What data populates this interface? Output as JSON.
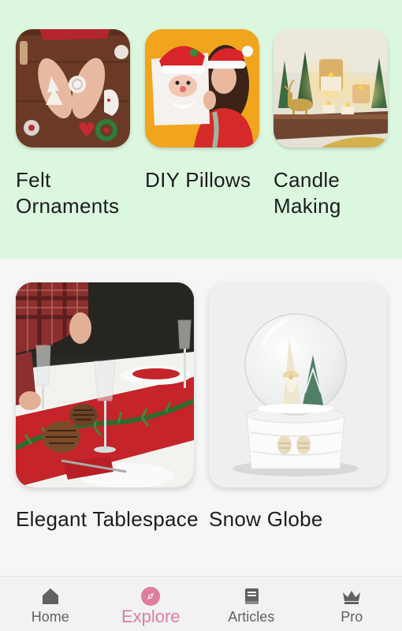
{
  "featured": [
    {
      "title": "Felt Ornaments",
      "image": "felt-ornaments-photo"
    },
    {
      "title": "DIY Pillows",
      "image": "diy-pillows-photo"
    },
    {
      "title": "Candle Making",
      "image": "candle-making-photo"
    }
  ],
  "projects": [
    {
      "title": "Elegant Tablespace",
      "image": "table-setting-photo"
    },
    {
      "title": "Snow Globe",
      "image": "snow-globe-photo"
    }
  ],
  "nav": {
    "active": "Explore",
    "items": [
      {
        "label": "Home",
        "icon": "home-icon"
      },
      {
        "label": "Explore",
        "icon": "compass-icon"
      },
      {
        "label": "Articles",
        "icon": "book-icon"
      },
      {
        "label": "Pro",
        "icon": "crown-icon"
      }
    ]
  },
  "colors": {
    "top_background": "#dbf7e0",
    "accent": "#e07ca0",
    "nav_inactive": "#616161"
  }
}
